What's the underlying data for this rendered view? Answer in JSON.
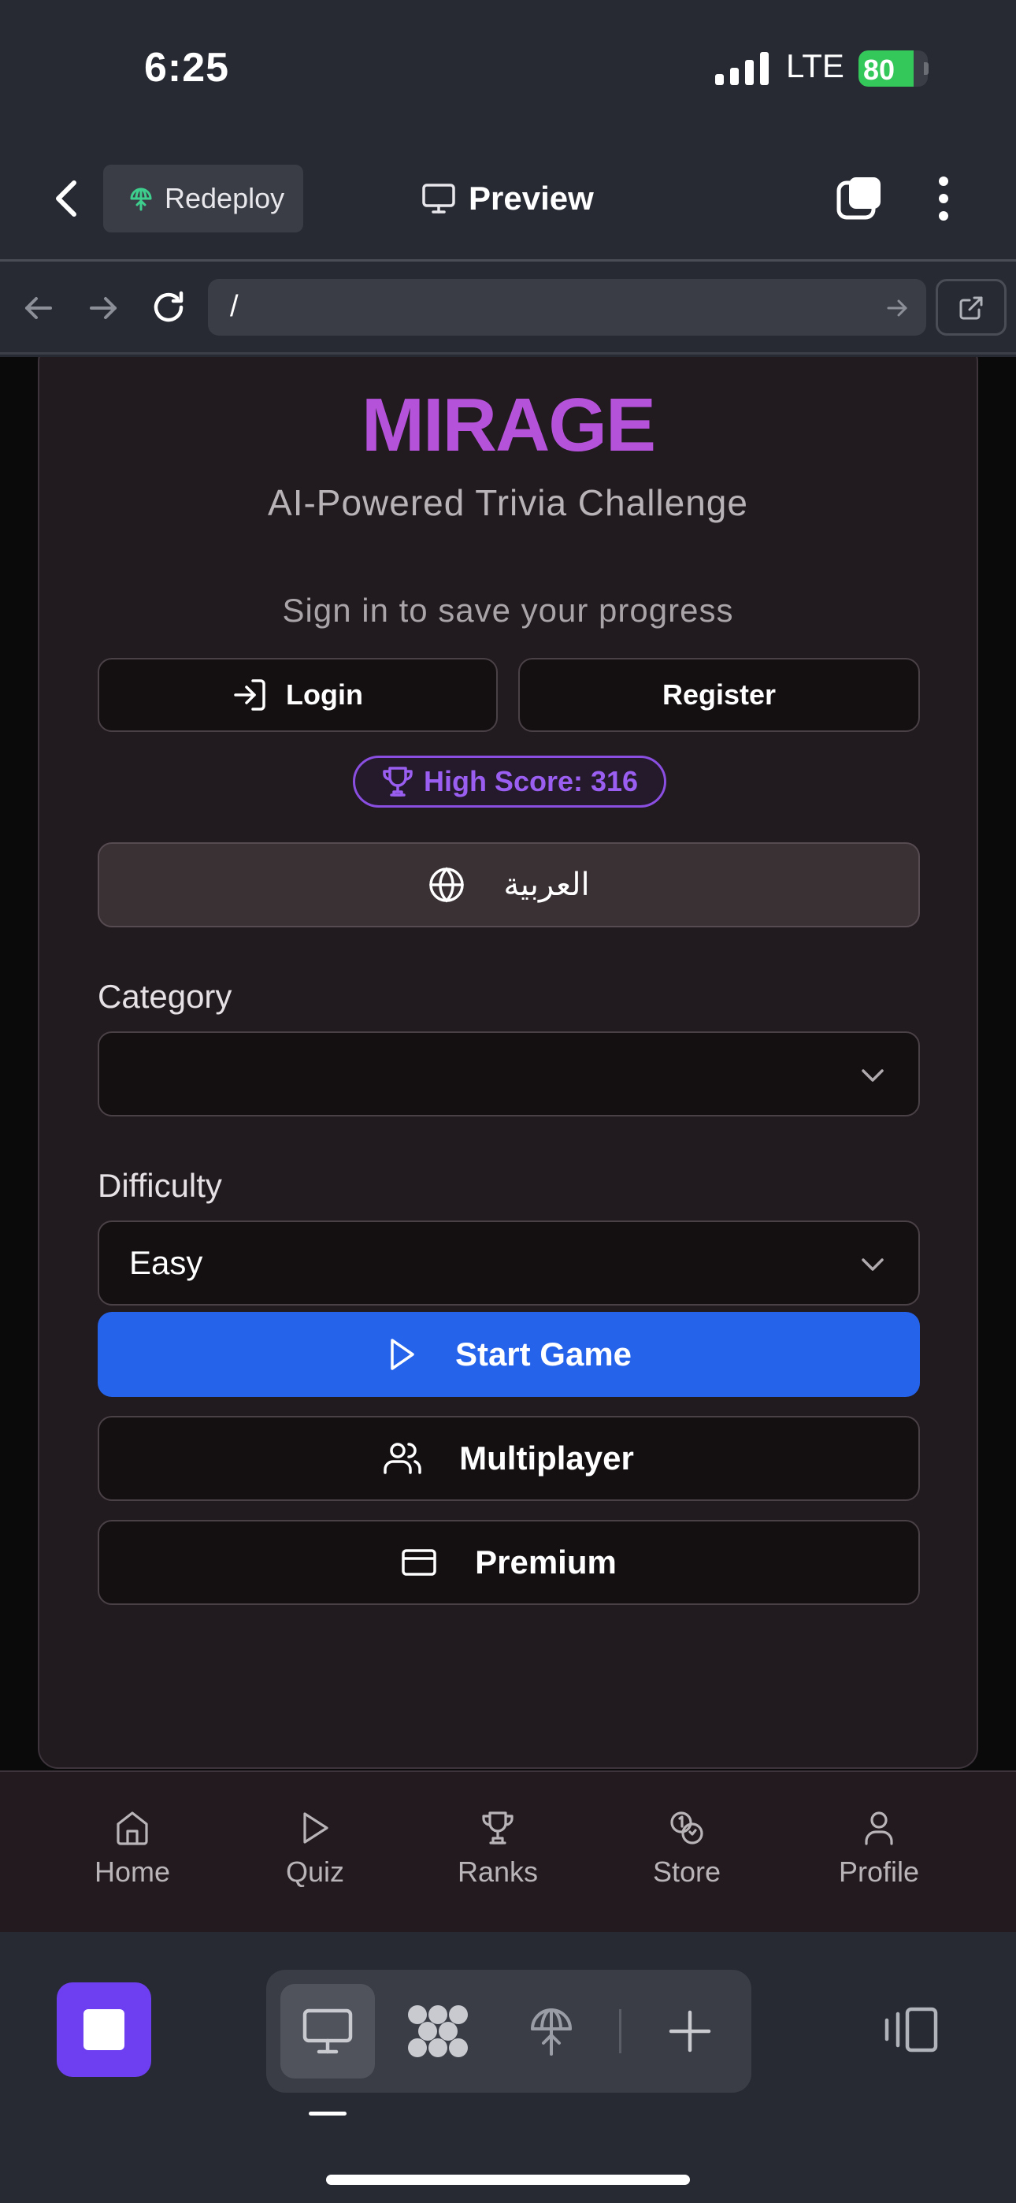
{
  "status_bar": {
    "time": "6:25",
    "network": "LTE",
    "battery": "80",
    "battery_fraction": 0.8
  },
  "header": {
    "redeploy_label": "Redeploy",
    "preview_label": "Preview"
  },
  "browser": {
    "url": "/"
  },
  "app": {
    "title": "MIRAGE",
    "subtitle": "AI-Powered Trivia Challenge",
    "signin_prompt": "Sign in to save your progress",
    "login_label": "Login",
    "register_label": "Register",
    "high_score": "High Score: 316",
    "language_label": "العربية",
    "category_label": "Category",
    "category_value": "",
    "difficulty_label": "Difficulty",
    "difficulty_value": "Easy",
    "start_game_label": "Start Game",
    "multiplayer_label": "Multiplayer",
    "premium_label": "Premium"
  },
  "bottom_nav": {
    "items": [
      {
        "label": "Home",
        "icon": "home-icon"
      },
      {
        "label": "Quiz",
        "icon": "play-icon"
      },
      {
        "label": "Ranks",
        "icon": "trophy-icon"
      },
      {
        "label": "Store",
        "icon": "coins-icon"
      },
      {
        "label": "Profile",
        "icon": "user-icon"
      }
    ]
  },
  "colors": {
    "title": "#b452d9",
    "primary_button": "#2563eb",
    "badge": "#9a5ef0",
    "launcher": "#6d3ff0",
    "battery": "#34c759"
  }
}
